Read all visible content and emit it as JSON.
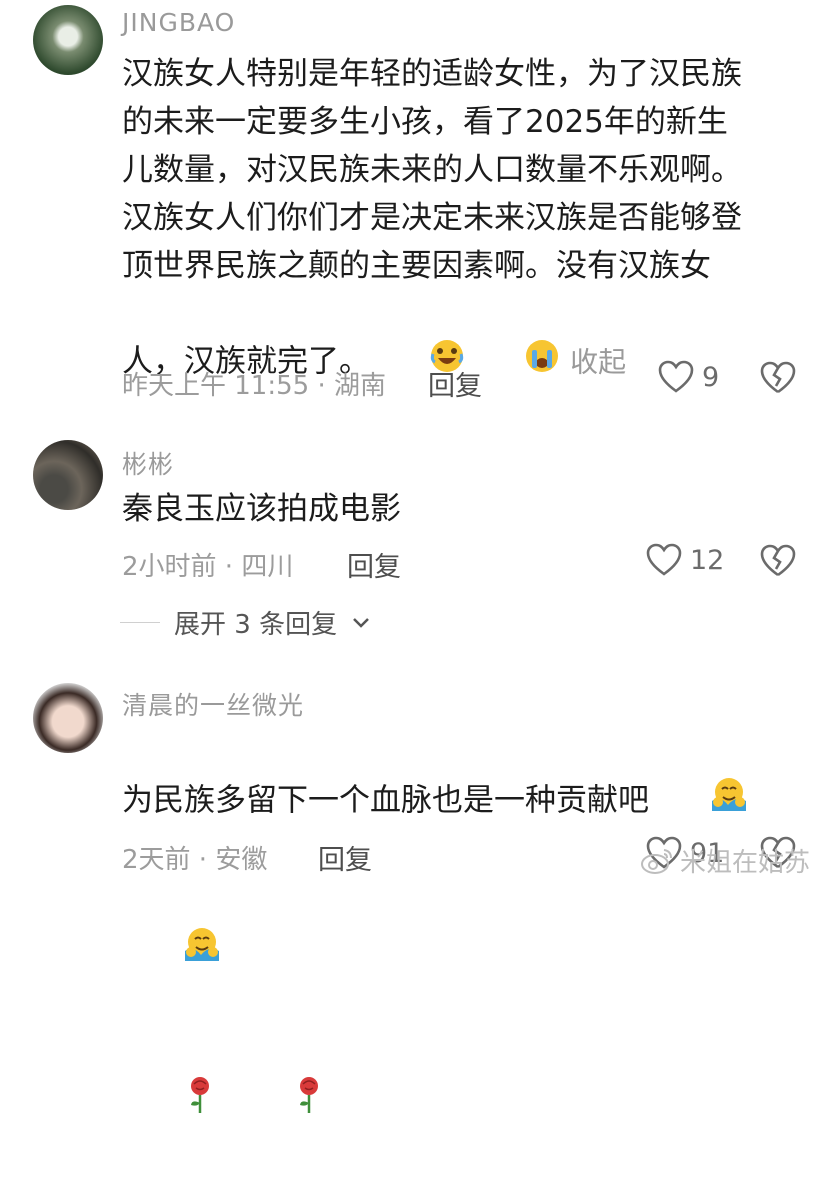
{
  "comments": [
    {
      "username": "JINGBAO",
      "text": "汉族女人特别是年轻的适龄女性，为了汉民族\n的未来一定要多生小孩，看了2025年的新生\n儿数量，对汉民族未来的人口数量不乐观啊。\n汉族女人们你们才是决定未来汉族是否能够登\n顶世界民族之颠的主要因素啊。没有汉族女\n人，汉族就完了。",
      "collapse_label": "收起",
      "meta": "昨天上午 11:55 · 湖南",
      "reply_label": "回复",
      "likes": "9"
    },
    {
      "username": "彬彬",
      "text": "秦良玉应该拍成电影",
      "meta": "2小时前 · 四川",
      "reply_label": "回复",
      "likes": "12"
    },
    {
      "username": "清晨的一丝微光",
      "text": "为民族多留下一个血脉也是一种贡献吧",
      "meta": "2天前 · 安徽",
      "reply_label": "回复",
      "likes": "91"
    }
  ],
  "expand_replies": "展开 3 条回复",
  "watermark": "米姐在姑苏",
  "colors": {
    "meta_gray": "#9c9c9c",
    "text": "#1c1c1c",
    "rose": "#d83a3a"
  }
}
